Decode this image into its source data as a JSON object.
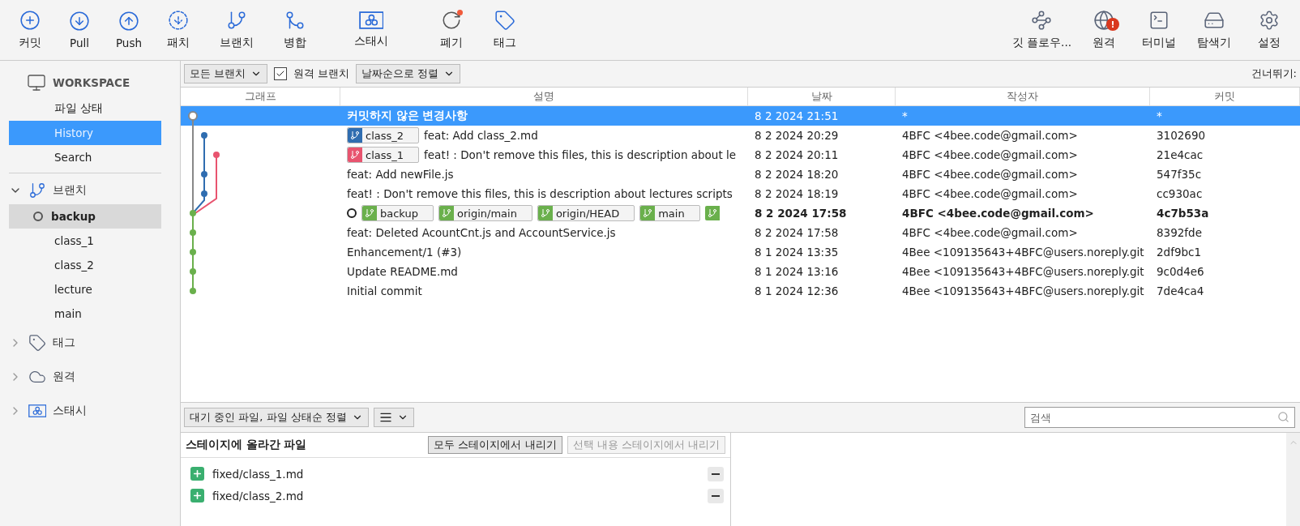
{
  "toolbar": {
    "left": [
      {
        "label": "커밋"
      },
      {
        "label": "Pull"
      },
      {
        "label": "Push"
      },
      {
        "label": "패치"
      },
      {
        "label": "브랜치"
      },
      {
        "label": "병합"
      },
      {
        "label": "스태시"
      },
      {
        "label": "폐기",
        "dot": true
      },
      {
        "label": "태그"
      }
    ],
    "right": [
      {
        "label": "깃 플로우..."
      },
      {
        "label": "원격",
        "badge": "!"
      },
      {
        "label": "터미널"
      },
      {
        "label": "탐색기"
      },
      {
        "label": "설정"
      }
    ]
  },
  "sidebar": {
    "workspace": {
      "title": "WORKSPACE",
      "items": [
        {
          "label": "파일 상태",
          "selected": false
        },
        {
          "label": "History",
          "selected": true
        },
        {
          "label": "Search",
          "selected": false
        }
      ]
    },
    "groups": [
      {
        "label": "브랜치",
        "expanded": true,
        "children": [
          {
            "label": "backup",
            "selected": true,
            "current": true
          },
          {
            "label": "class_1",
            "selected": false,
            "current": false
          },
          {
            "label": "class_2",
            "selected": false,
            "current": false
          },
          {
            "label": "lecture",
            "selected": false,
            "current": false
          },
          {
            "label": "main",
            "selected": false,
            "current": false
          }
        ]
      },
      {
        "label": "태그",
        "expanded": false
      },
      {
        "label": "원격",
        "expanded": false
      },
      {
        "label": "스태시",
        "expanded": false
      }
    ]
  },
  "filter_bar": {
    "branches": "모든 브랜치",
    "remote_branches": {
      "label": "원격 브랜치",
      "checked": true
    },
    "sort": "날짜순으로 정렬",
    "jump": "건너뛰기:"
  },
  "table": {
    "columns": [
      "그래프",
      "설명",
      "날짜",
      "작성자",
      "커밋"
    ],
    "rows": [
      {
        "kind": "uncommitted",
        "description": "커밋하지 않은 변경사항",
        "date": "8 2 2024 21:51",
        "author": "*",
        "commit": "*",
        "selected": true,
        "bold": false,
        "head": false,
        "tags": []
      },
      {
        "description": "feat: Add class_2.md",
        "date": "8 2 2024 20:29",
        "author": "4BFC <4bee.code@gmail.com>",
        "commit": "3102690",
        "selected": false,
        "bold": false,
        "head": false,
        "tags": [
          {
            "label": "class_2",
            "color": "#2f6db0"
          }
        ]
      },
      {
        "description": "feat! : Don't remove this files, this is description about le",
        "date": "8 2 2024 20:11",
        "author": "4BFC <4bee.code@gmail.com>",
        "commit": "21e4cac",
        "selected": false,
        "bold": false,
        "head": false,
        "tags": [
          {
            "label": "class_1",
            "color": "#e8546f"
          }
        ]
      },
      {
        "description": "feat: Add newFile.js",
        "date": "8 2 2024 18:20",
        "author": "4BFC <4bee.code@gmail.com>",
        "commit": "547f35c",
        "selected": false,
        "bold": false,
        "head": false,
        "tags": []
      },
      {
        "description": "feat! : Don't remove this files, this is description about lectures scripts",
        "date": "8 2 2024 18:19",
        "author": "4BFC <4bee.code@gmail.com>",
        "commit": "cc930ac",
        "selected": false,
        "bold": false,
        "head": false,
        "tags": []
      },
      {
        "date": "8 2 2024 17:58",
        "author": "4BFC <4bee.code@gmail.com>",
        "commit": "4c7b53a",
        "selected": false,
        "bold": true,
        "head": true,
        "tags": [
          {
            "label": "backup",
            "color": "#6ab04c"
          },
          {
            "label": "origin/main",
            "color": "#6ab04c"
          },
          {
            "label": "origin/HEAD",
            "color": "#6ab04c"
          },
          {
            "label": "main",
            "color": "#6ab04c"
          },
          {
            "color": "#6ab04c"
          }
        ]
      },
      {
        "description": "feat: Deleted AcountCnt.js and AccountService.js",
        "date": "8 2 2024 17:58",
        "author": "4BFC <4bee.code@gmail.com>",
        "commit": "8392fde",
        "selected": false,
        "bold": false,
        "head": false,
        "tags": []
      },
      {
        "description": "Enhancement/1 (#3)",
        "date": "8 1 2024 13:35",
        "author": "4Bee <109135643+4BFC@users.noreply.git",
        "commit": "2df9bc1",
        "selected": false,
        "bold": false,
        "head": false,
        "tags": []
      },
      {
        "description": "Update README.md",
        "date": "8 1 2024 13:16",
        "author": "4Bee <109135643+4BFC@users.noreply.git",
        "commit": "9c0d4e6",
        "selected": false,
        "bold": false,
        "head": false,
        "tags": []
      },
      {
        "description": "Initial commit",
        "date": "8 1 2024 12:36",
        "author": "4Bee <109135643+4BFC@users.noreply.git",
        "commit": "7de4ca4",
        "selected": false,
        "bold": false,
        "head": false,
        "tags": []
      }
    ]
  },
  "bottom_bar": {
    "sort": "대기 중인 파일, 파일 상태순 정렬",
    "search": {
      "placeholder": "검색"
    }
  },
  "staged": {
    "title": "스테이지에 올라간 파일",
    "buttons": [
      {
        "label": "모두 스테이지에서 내리기",
        "disabled": false
      },
      {
        "label": "선택 내용 스테이지에서 내리기",
        "disabled": true
      }
    ],
    "files": [
      {
        "path": "fixed/class_1.md",
        "kind": "added"
      },
      {
        "path": "fixed/class_2.md",
        "kind": "added"
      }
    ]
  }
}
